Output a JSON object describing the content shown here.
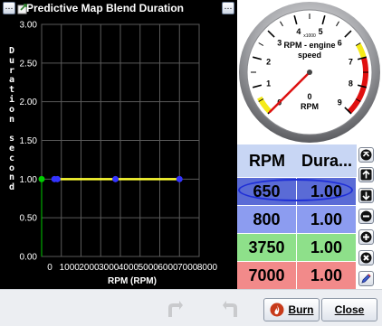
{
  "window": {
    "title": "Predictive Map Blend Duration"
  },
  "chart_data": {
    "type": "line",
    "title": "Predictive Map Blend Duration",
    "xlabel": "RPM (RPM)",
    "ylabel": "Duration second",
    "x_tick_labels": [
      "0",
      "1000",
      "2000",
      "3000",
      "4000",
      "5000",
      "6000",
      "7000",
      "8000"
    ],
    "y_tick_labels": [
      "0.00",
      "0.50",
      "1.00",
      "1.50",
      "2.00",
      "2.50",
      "3.00"
    ],
    "xlim": [
      0,
      8000
    ],
    "ylim": [
      0,
      3
    ],
    "grid": true,
    "series": [
      {
        "x": [
          650,
          800,
          3750,
          7000
        ],
        "y": [
          1.0,
          1.0,
          1.0,
          1.0
        ],
        "color": "#ffff33",
        "marker_color": "#3333ff"
      }
    ],
    "cursor_x": 0,
    "cursor_color": "#00cc00"
  },
  "gauge": {
    "title_line1": "RPM - engine",
    "title_line2": "speed",
    "multiplier": "x1000",
    "value_text": "0",
    "units": "RPM",
    "ticks": [
      "0",
      "1",
      "2",
      "3",
      "4",
      "5",
      "6",
      "7",
      "8",
      "9"
    ],
    "min": 0,
    "max": 9,
    "value": 0,
    "warn_range": [
      6.5,
      7.0
    ],
    "danger_range": [
      7.0,
      9.0
    ]
  },
  "table": {
    "headers": [
      "RPM",
      "Dura..."
    ],
    "rows": [
      {
        "rpm": "650",
        "duration": "1.00",
        "color": "#5a6bd6",
        "selected": true
      },
      {
        "rpm": "800",
        "duration": "1.00",
        "color": "#8c9cf0",
        "selected": false
      },
      {
        "rpm": "3750",
        "duration": "1.00",
        "color": "#8ee08a",
        "selected": false
      },
      {
        "rpm": "7000",
        "duration": "1.00",
        "color": "#f28a8a",
        "selected": false
      }
    ],
    "side_buttons": [
      "arrow-up-icon",
      "arrow-up-icon",
      "arrow-down-icon",
      "minus-icon",
      "plus-icon",
      "x-icon",
      "pencil-icon"
    ]
  },
  "buttons": {
    "burn": "Burn",
    "close": "Close"
  }
}
